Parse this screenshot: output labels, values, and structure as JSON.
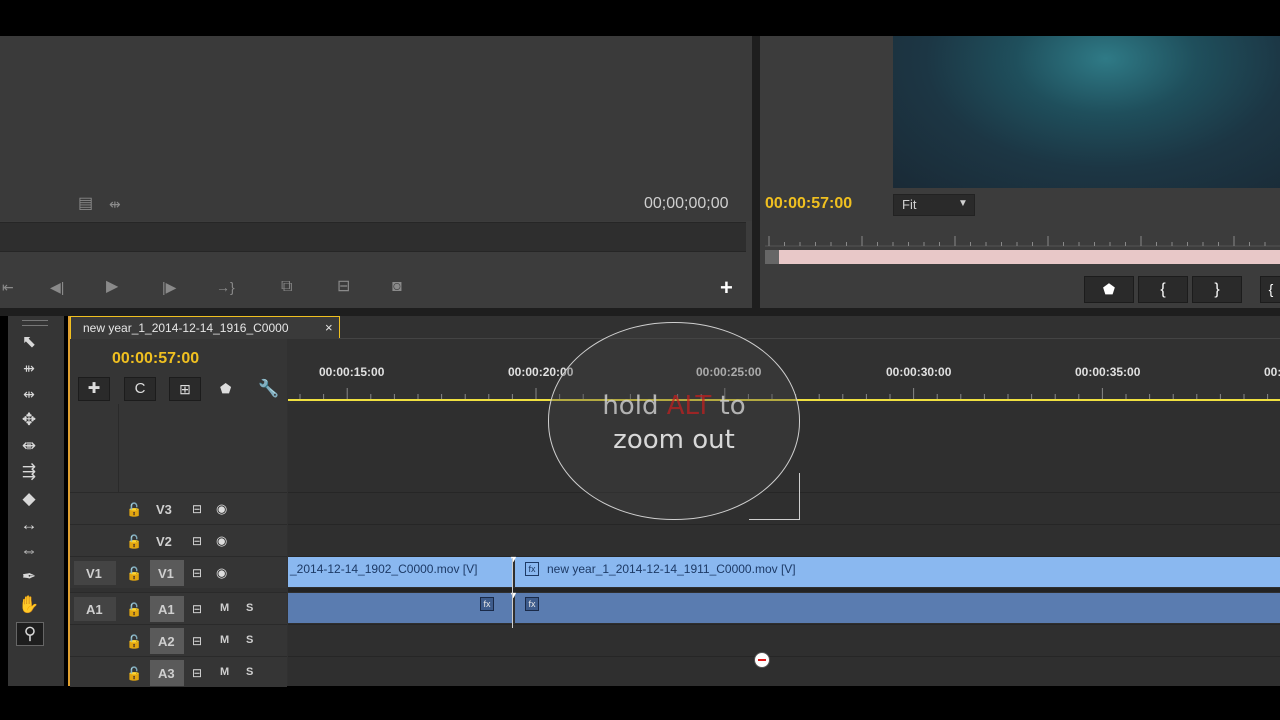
{
  "source_monitor": {
    "timecode": "00;00;00;00",
    "icons": [
      "film-strip-icon",
      "drag-handle-icon"
    ]
  },
  "program_monitor": {
    "timecode": "00:00:57:00",
    "zoom_select": "Fit"
  },
  "transport": {
    "add_label": "+"
  },
  "timeline": {
    "tab_title": "new year_1_2014-12-14_1916_C0000",
    "tab_close": "×",
    "timecode": "00:00:57:00",
    "ruler_labels": [
      "00:00:15:00",
      "00:00:20:00",
      "00:00:25:00",
      "00:00:30:00",
      "00:00:35:00",
      "00:0"
    ],
    "tracks": {
      "v3": "V3",
      "v2": "V2",
      "v1": "V1",
      "v1_source": "V1",
      "a1": "A1",
      "a1_source": "A1",
      "a2": "A2",
      "a3": "A3",
      "mute": "M",
      "solo": "S"
    },
    "clips": {
      "clip1_label": "_2014-12-14_1902_C0000.mov [V]",
      "clip2_label": "new year_1_2014-12-14_1911_C0000.mov [V]",
      "fx": "fx"
    }
  },
  "overlay": {
    "line1_pre": "hold ",
    "line1_key": "ALT",
    "line1_post": " to",
    "line2": "zoom out"
  },
  "colors": {
    "accent_yellow": "#f0c020",
    "video_clip": "#8ab8f0",
    "audio_clip": "#5a7cb0",
    "playhead": "#f0e040"
  }
}
